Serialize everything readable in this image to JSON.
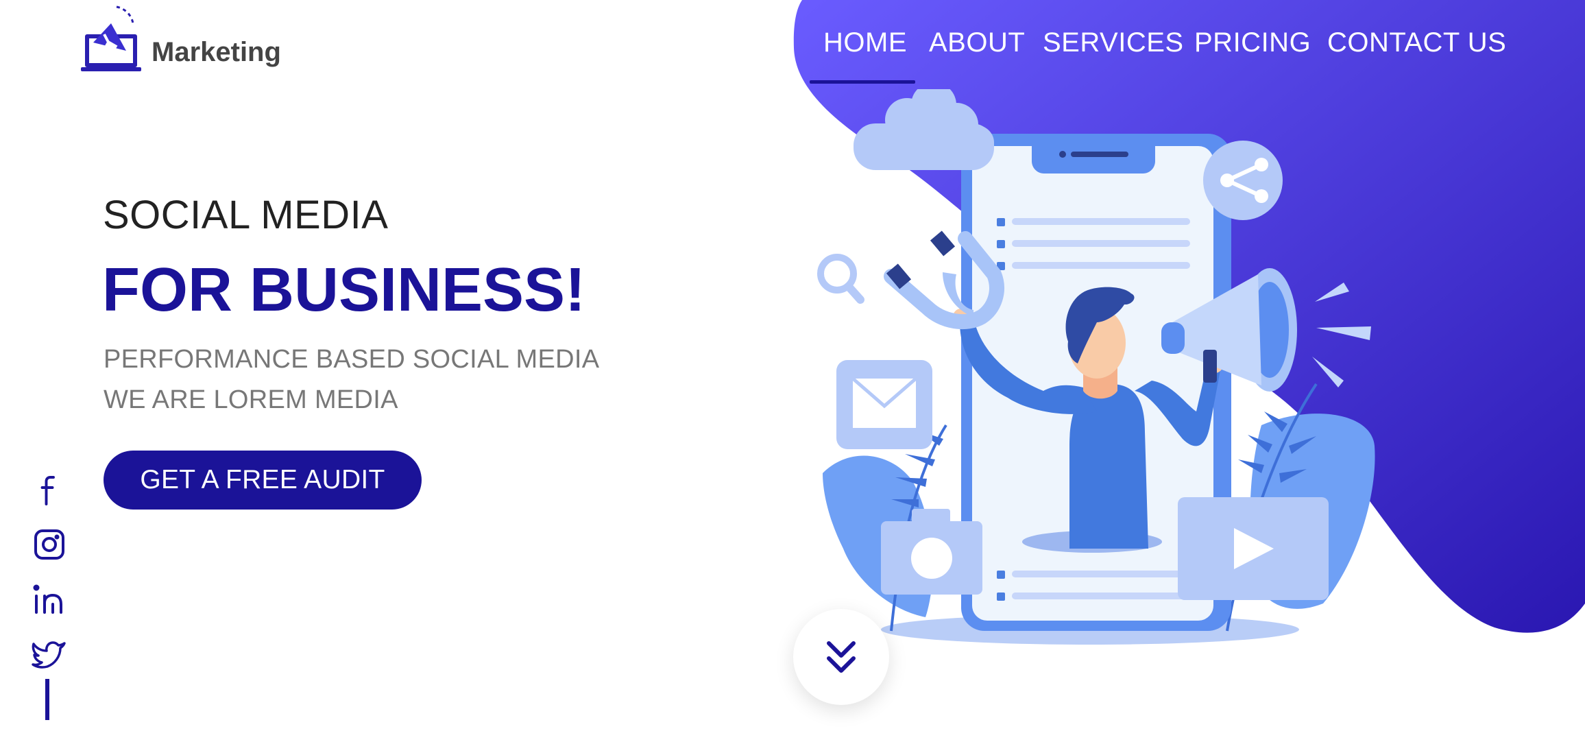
{
  "brand": {
    "name": "Marketing",
    "logo_icon": "megaphone-laptop-icon",
    "accent_color": "#1b1398",
    "gradient_colors": [
      "#6a5cff",
      "#2a17b1"
    ]
  },
  "nav": {
    "items": [
      {
        "label": "HOME",
        "active": true
      },
      {
        "label": "ABOUT",
        "active": false
      },
      {
        "label": "SERVICES",
        "active": false
      },
      {
        "label": "PRICING",
        "active": false
      },
      {
        "label": "CONTACT US",
        "active": false
      }
    ]
  },
  "hero": {
    "subtitle": "SOCIAL MEDIA",
    "title": "FOR BUSINESS!",
    "tagline_line1": "PERFORMANCE BASED SOCIAL MEDIA",
    "tagline_line2": "WE ARE LOREM MEDIA",
    "cta_label": "GET A FREE AUDIT"
  },
  "social": {
    "icons": [
      "facebook-icon",
      "instagram-icon",
      "linkedin-icon",
      "twitter-icon"
    ]
  },
  "scroll": {
    "icon": "double-chevron-down-icon"
  },
  "illustration": {
    "name": "social-media-marketing-illustration",
    "elements": [
      "cloud-icon",
      "share-icon",
      "search-icon",
      "magnet-icon",
      "mail-icon",
      "camera-icon",
      "play-icon",
      "megaphone-icon",
      "smartphone",
      "person"
    ]
  }
}
